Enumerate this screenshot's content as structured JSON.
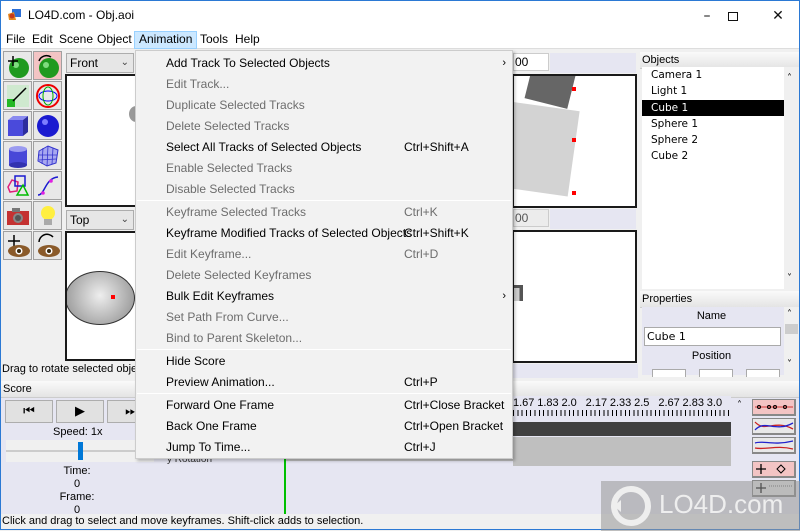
{
  "window": {
    "title": "LO4D.com - Obj.aoi",
    "minimize_label": "–",
    "maximize_label": "☐",
    "close_label": "✕"
  },
  "menubar": {
    "items": [
      "File",
      "Edit",
      "Scene",
      "Object",
      "Animation",
      "Tools",
      "Help"
    ],
    "active": "Animation"
  },
  "toolbox": {
    "tools": [
      {
        "name": "move-tool-icon",
        "selected": false
      },
      {
        "name": "rotate-tool-icon",
        "selected": true
      },
      {
        "name": "scale-tool-icon",
        "selected": false
      },
      {
        "name": "skew-tool-icon",
        "selected": false
      },
      {
        "name": "cube-tool-icon",
        "selected": false
      },
      {
        "name": "sphere-tool-icon",
        "selected": false
      },
      {
        "name": "cylinder-tool-icon",
        "selected": false
      },
      {
        "name": "polymesh-tool-icon",
        "selected": false
      },
      {
        "name": "polygon-tool-icon",
        "selected": false
      },
      {
        "name": "curve-tool-icon",
        "selected": false
      },
      {
        "name": "camera-tool-icon",
        "selected": false
      },
      {
        "name": "light-tool-icon",
        "selected": false
      },
      {
        "name": "move-view-tool-icon",
        "selected": false
      },
      {
        "name": "rotate-view-tool-icon",
        "selected": false
      }
    ]
  },
  "views": {
    "top_left_select": "Front",
    "bottom_left_select": "Top",
    "top_right_field": "00",
    "bottom_right_field": "00"
  },
  "status": {
    "view_hint": "Drag to rotate selected objec",
    "bottom_hint": "Click and drag to select and move keyframes.  Shift-click adds to selection."
  },
  "objects_panel": {
    "title": "Objects",
    "items": [
      "Camera 1",
      "Light 1",
      "Cube 1",
      "Sphere 1",
      "Sphere 2",
      "Cube 2"
    ],
    "selected": "Cube 1"
  },
  "properties_panel": {
    "title": "Properties",
    "name_label": "Name",
    "name_value": "Cube 1",
    "position_label": "Position"
  },
  "score": {
    "title": "Score",
    "speed_label": "Speed: 1x",
    "speed_fraction": 0.5,
    "time_label": "Time:",
    "time_value": "0",
    "frame_label": "Frame:",
    "frame_value": "0",
    "track_fragment": "y Rotation",
    "ruler_ticks": [
      "1.67",
      "1.83",
      "2.0",
      "2.17",
      "2.33",
      "2.5",
      "2.67",
      "2.83",
      "3.0"
    ]
  },
  "animation_menu": {
    "items": [
      {
        "label": "Add Track To Selected Objects",
        "shortcut": "",
        "enabled": true,
        "submenu": true
      },
      {
        "label": "Edit Track...",
        "shortcut": "",
        "enabled": false,
        "submenu": false
      },
      {
        "label": "Duplicate Selected Tracks",
        "shortcut": "",
        "enabled": false,
        "submenu": false
      },
      {
        "label": "Delete Selected Tracks",
        "shortcut": "",
        "enabled": false,
        "submenu": false
      },
      {
        "label": "Select All Tracks of Selected Objects",
        "shortcut": "Ctrl+Shift+A",
        "enabled": true,
        "submenu": false
      },
      {
        "label": "Enable Selected Tracks",
        "shortcut": "",
        "enabled": false,
        "submenu": false
      },
      {
        "label": "Disable Selected Tracks",
        "shortcut": "",
        "enabled": false,
        "submenu": false
      },
      {
        "label": "Keyframe Selected Tracks",
        "shortcut": "Ctrl+K",
        "enabled": false,
        "submenu": false
      },
      {
        "label": "Keyframe Modified Tracks of Selected Objects",
        "shortcut": "Ctrl+Shift+K",
        "enabled": true,
        "submenu": false
      },
      {
        "label": "Edit Keyframe...",
        "shortcut": "Ctrl+D",
        "enabled": false,
        "submenu": false
      },
      {
        "label": "Delete Selected Keyframes",
        "shortcut": "",
        "enabled": false,
        "submenu": false
      },
      {
        "label": "Bulk Edit Keyframes",
        "shortcut": "",
        "enabled": true,
        "submenu": true
      },
      {
        "label": "Set Path From Curve...",
        "shortcut": "",
        "enabled": false,
        "submenu": false
      },
      {
        "label": "Bind to Parent Skeleton...",
        "shortcut": "",
        "enabled": false,
        "submenu": false
      },
      {
        "label": "Hide Score",
        "shortcut": "",
        "enabled": true,
        "submenu": false
      },
      {
        "label": "Preview Animation...",
        "shortcut": "Ctrl+P",
        "enabled": true,
        "submenu": false
      },
      {
        "label": "Forward One Frame",
        "shortcut": "Ctrl+Close Bracket",
        "enabled": true,
        "submenu": false
      },
      {
        "label": "Back One Frame",
        "shortcut": "Ctrl+Open Bracket",
        "enabled": true,
        "submenu": false
      },
      {
        "label": "Jump To Time...",
        "shortcut": "Ctrl+J",
        "enabled": true,
        "submenu": false
      }
    ],
    "submenu_arrow": "›"
  },
  "watermark": {
    "text": "LO4D.com"
  },
  "colors": {
    "selection_bg": "#000000",
    "menu_active_bg": "#cce8ff",
    "tool_selected_bg": "#f3c4c4",
    "score_bg": "#e6e6f2",
    "timeline_cursor": "#00c000",
    "handle_red": "#ff0000"
  }
}
